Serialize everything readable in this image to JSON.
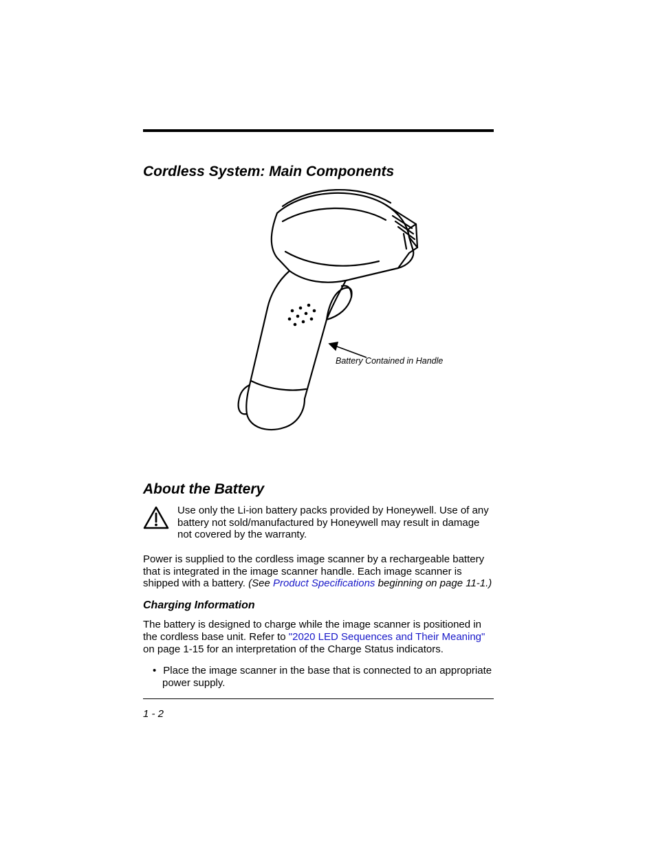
{
  "heading1": "Cordless System: Main Components",
  "figure": {
    "callout": "Battery Contained in Handle"
  },
  "heading2": "About the Battery",
  "warning": "Use only the Li-ion battery packs provided by Honeywell.  Use of any battery not sold/manufactured by Honeywell may result in damage not covered by the warranty.",
  "para_power_a": "Power is supplied to the cordless image scanner by a rechargeable battery that is integrated in the image scanner handle.  Each image scanner is shipped with a battery.  ",
  "para_power_see_open": "(See ",
  "para_power_link": "Product Specifications",
  "para_power_see_close": " beginning on page 11-1.)",
  "subheading": "Charging Information",
  "para_charge_a": "The battery is designed to charge while the image scanner is positioned in the cordless base unit.  Refer to ",
  "para_charge_link": "\"2020 LED Sequences and Their Meaning\"",
  "para_charge_b": " on page 1-15 for an interpretation of the Charge Status indicators.",
  "bullet1": "Place the image scanner in the base that is connected to an appropriate power supply.",
  "page_number": "1 - 2"
}
